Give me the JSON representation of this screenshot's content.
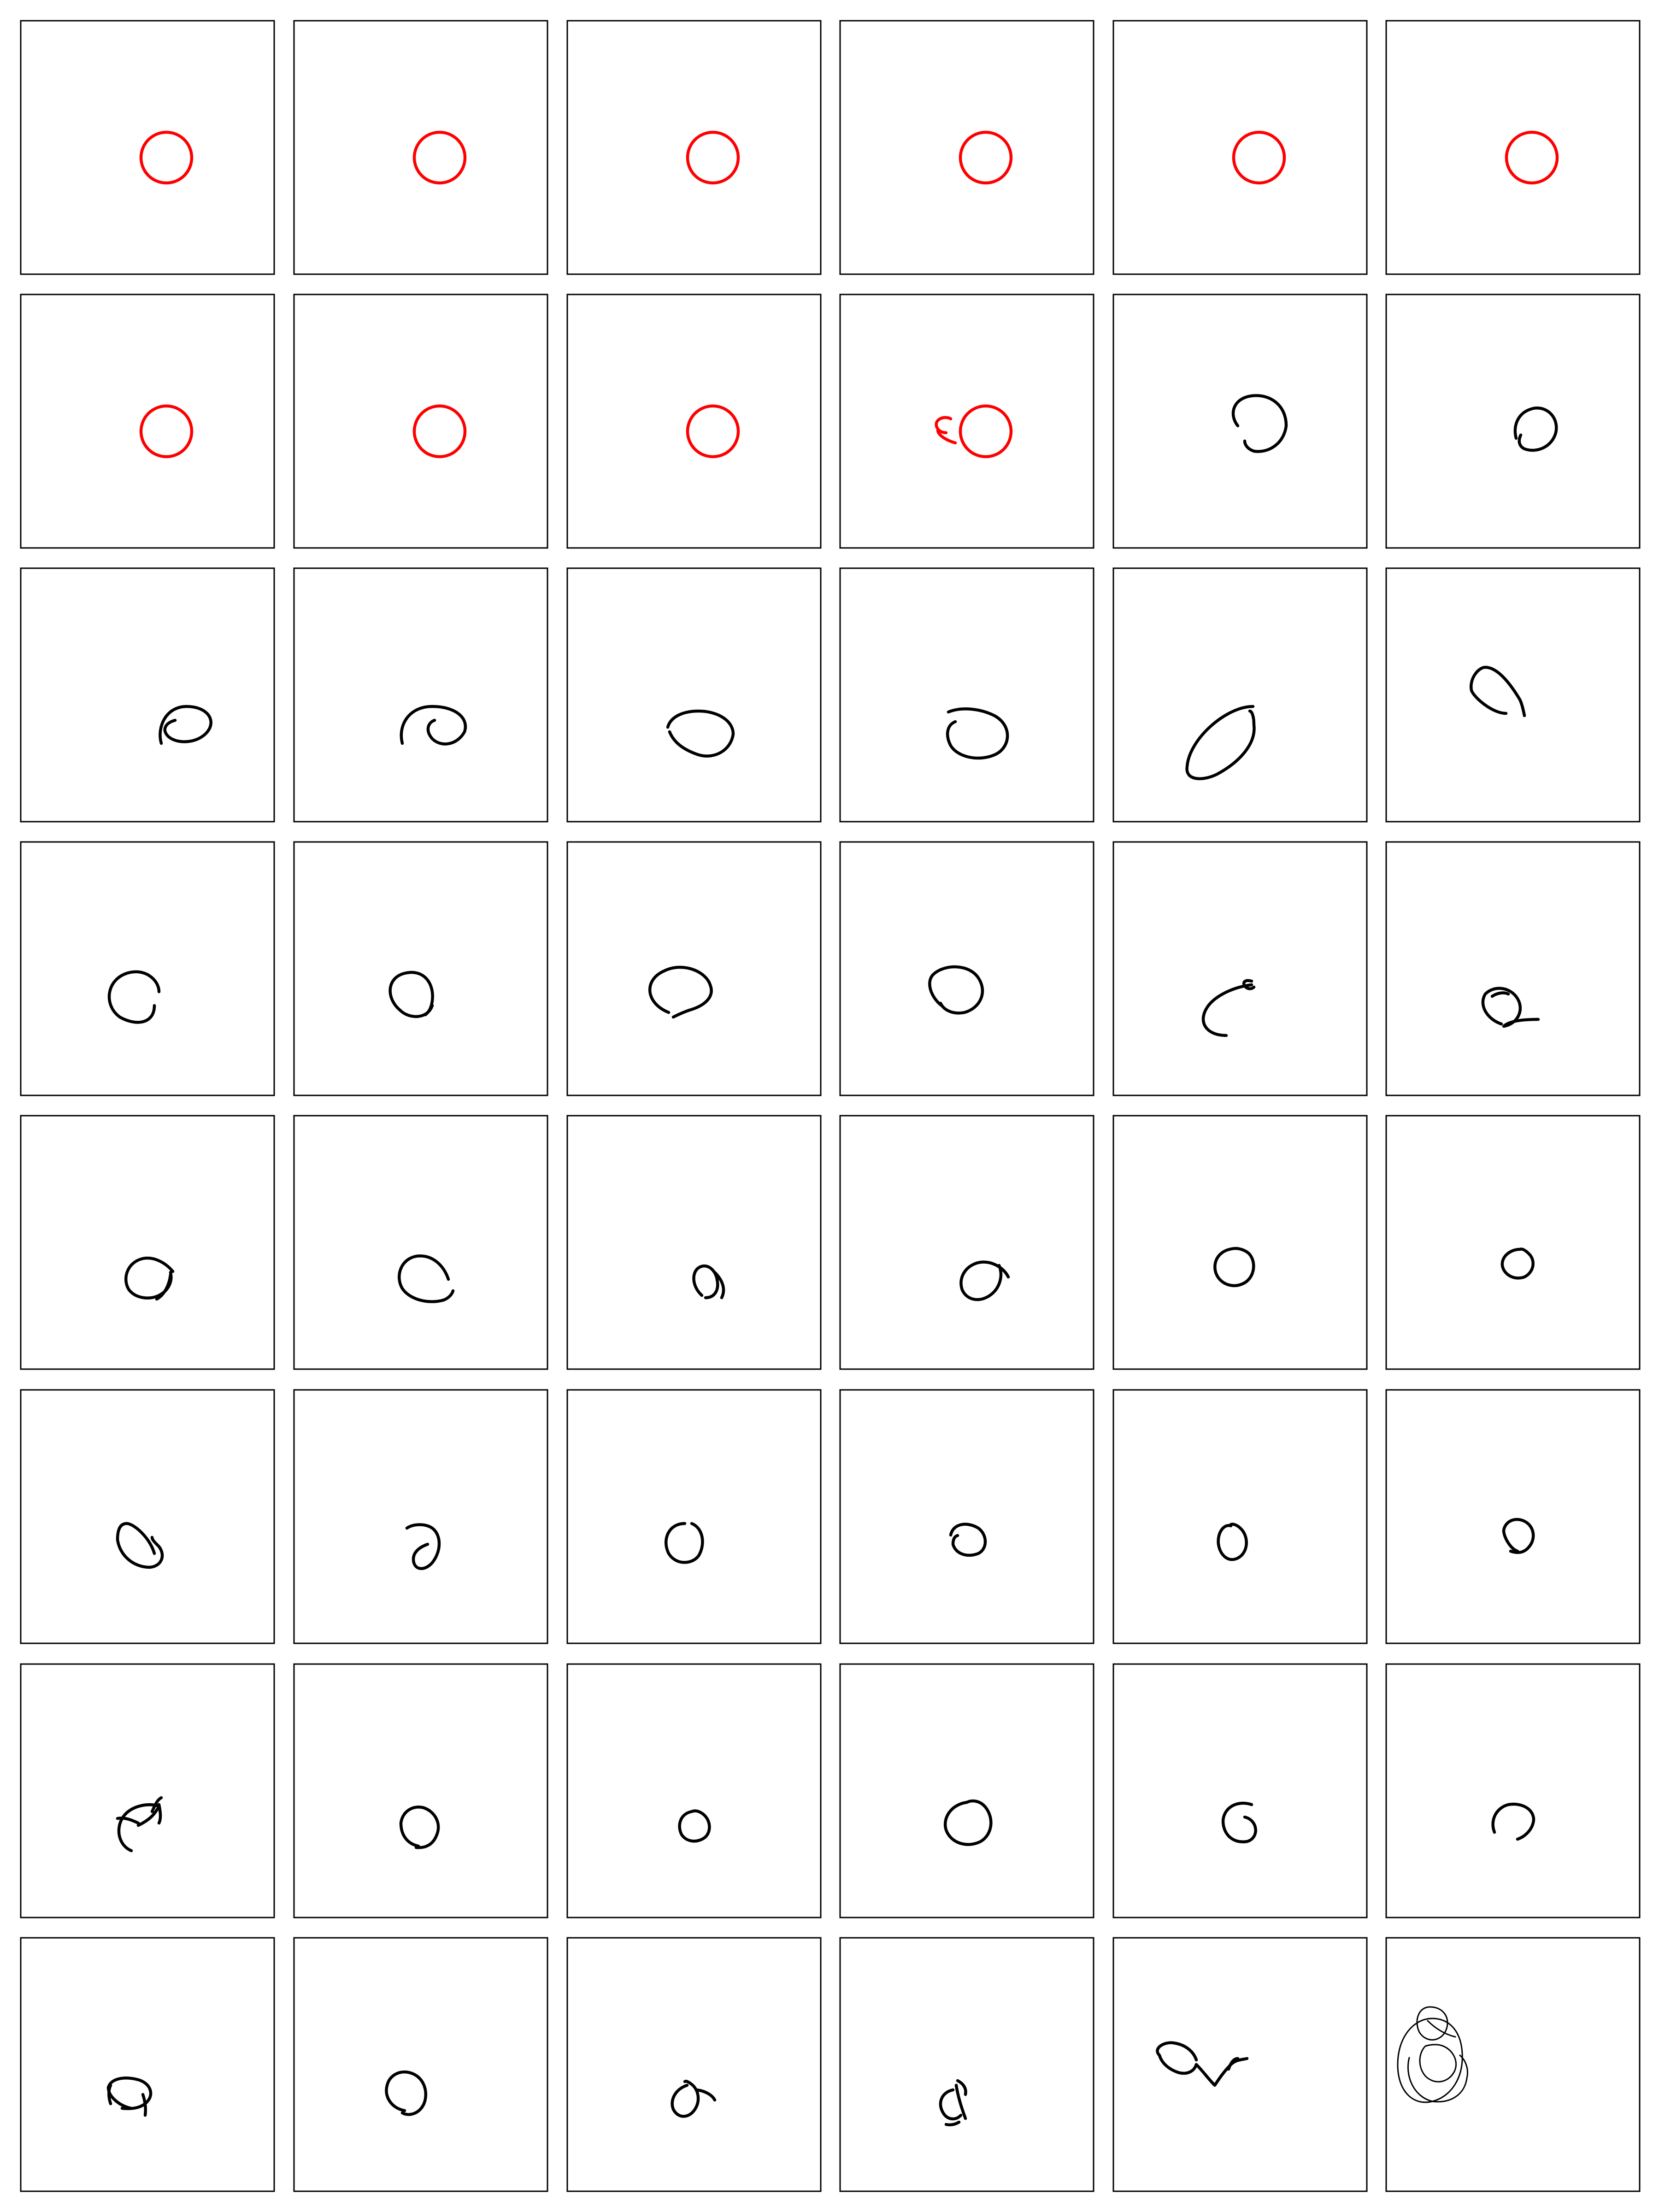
{
  "grid": {
    "rows": 8,
    "columns": 6
  },
  "colors": {
    "template": "#ff0000",
    "drawing": "#000000",
    "frame": "#000000",
    "background": "#ffffff"
  },
  "cells": [
    {
      "row": 1,
      "column": 1,
      "kind": "template-circle",
      "color": "#ff0000"
    },
    {
      "row": 1,
      "column": 2,
      "kind": "template-circle",
      "color": "#ff0000"
    },
    {
      "row": 1,
      "column": 3,
      "kind": "template-circle",
      "color": "#ff0000"
    },
    {
      "row": 1,
      "column": 4,
      "kind": "template-circle",
      "color": "#ff0000"
    },
    {
      "row": 1,
      "column": 5,
      "kind": "template-circle",
      "color": "#ff0000"
    },
    {
      "row": 1,
      "column": 6,
      "kind": "template-circle",
      "color": "#ff0000"
    },
    {
      "row": 2,
      "column": 1,
      "kind": "template-circle",
      "color": "#ff0000"
    },
    {
      "row": 2,
      "column": 2,
      "kind": "template-circle",
      "color": "#ff0000"
    },
    {
      "row": 2,
      "column": 3,
      "kind": "template-circle",
      "color": "#ff0000"
    },
    {
      "row": 2,
      "column": 4,
      "kind": "template-circle-with-tail",
      "color": "#ff0000"
    },
    {
      "row": 2,
      "column": 5,
      "kind": "hand-drawn-circle",
      "color": "#000000"
    },
    {
      "row": 2,
      "column": 6,
      "kind": "hand-drawn-circle",
      "color": "#000000"
    },
    {
      "row": 3,
      "column": 1,
      "kind": "hand-drawn-circle",
      "color": "#000000"
    },
    {
      "row": 3,
      "column": 2,
      "kind": "hand-drawn-circle",
      "color": "#000000"
    },
    {
      "row": 3,
      "column": 3,
      "kind": "hand-drawn-circle",
      "color": "#000000"
    },
    {
      "row": 3,
      "column": 4,
      "kind": "hand-drawn-circle",
      "color": "#000000"
    },
    {
      "row": 3,
      "column": 5,
      "kind": "hand-drawn-circle",
      "color": "#000000"
    },
    {
      "row": 3,
      "column": 6,
      "kind": "hand-drawn-circle",
      "color": "#000000"
    },
    {
      "row": 4,
      "column": 1,
      "kind": "hand-drawn-circle",
      "color": "#000000"
    },
    {
      "row": 4,
      "column": 2,
      "kind": "hand-drawn-circle",
      "color": "#000000"
    },
    {
      "row": 4,
      "column": 3,
      "kind": "hand-drawn-circle",
      "color": "#000000"
    },
    {
      "row": 4,
      "column": 4,
      "kind": "hand-drawn-circle",
      "color": "#000000"
    },
    {
      "row": 4,
      "column": 5,
      "kind": "hand-drawn-circle",
      "color": "#000000"
    },
    {
      "row": 4,
      "column": 6,
      "kind": "hand-drawn-circle",
      "color": "#000000"
    },
    {
      "row": 5,
      "column": 1,
      "kind": "hand-drawn-circle",
      "color": "#000000"
    },
    {
      "row": 5,
      "column": 2,
      "kind": "hand-drawn-circle",
      "color": "#000000"
    },
    {
      "row": 5,
      "column": 3,
      "kind": "hand-drawn-circle",
      "color": "#000000"
    },
    {
      "row": 5,
      "column": 4,
      "kind": "hand-drawn-circle",
      "color": "#000000"
    },
    {
      "row": 5,
      "column": 5,
      "kind": "hand-drawn-circle",
      "color": "#000000"
    },
    {
      "row": 5,
      "column": 6,
      "kind": "hand-drawn-circle",
      "color": "#000000"
    },
    {
      "row": 6,
      "column": 1,
      "kind": "hand-drawn-circle",
      "color": "#000000"
    },
    {
      "row": 6,
      "column": 2,
      "kind": "hand-drawn-circle",
      "color": "#000000"
    },
    {
      "row": 6,
      "column": 3,
      "kind": "hand-drawn-circle",
      "color": "#000000"
    },
    {
      "row": 6,
      "column": 4,
      "kind": "hand-drawn-circle",
      "color": "#000000"
    },
    {
      "row": 6,
      "column": 5,
      "kind": "hand-drawn-circle",
      "color": "#000000"
    },
    {
      "row": 6,
      "column": 6,
      "kind": "hand-drawn-circle",
      "color": "#000000"
    },
    {
      "row": 7,
      "column": 1,
      "kind": "hand-drawn-circle",
      "color": "#000000"
    },
    {
      "row": 7,
      "column": 2,
      "kind": "hand-drawn-circle",
      "color": "#000000"
    },
    {
      "row": 7,
      "column": 3,
      "kind": "hand-drawn-circle",
      "color": "#000000"
    },
    {
      "row": 7,
      "column": 4,
      "kind": "hand-drawn-circle",
      "color": "#000000"
    },
    {
      "row": 7,
      "column": 5,
      "kind": "hand-drawn-circle",
      "color": "#000000"
    },
    {
      "row": 7,
      "column": 6,
      "kind": "hand-drawn-circle",
      "color": "#000000"
    },
    {
      "row": 8,
      "column": 1,
      "kind": "hand-drawn-circle",
      "color": "#000000"
    },
    {
      "row": 8,
      "column": 2,
      "kind": "hand-drawn-circle",
      "color": "#000000"
    },
    {
      "row": 8,
      "column": 3,
      "kind": "hand-drawn-circle",
      "color": "#000000"
    },
    {
      "row": 8,
      "column": 4,
      "kind": "hand-drawn-circle",
      "color": "#000000"
    },
    {
      "row": 8,
      "column": 5,
      "kind": "hand-drawn-scribble",
      "color": "#000000"
    },
    {
      "row": 8,
      "column": 6,
      "kind": "overlapping-circles",
      "color": "#000000"
    }
  ]
}
